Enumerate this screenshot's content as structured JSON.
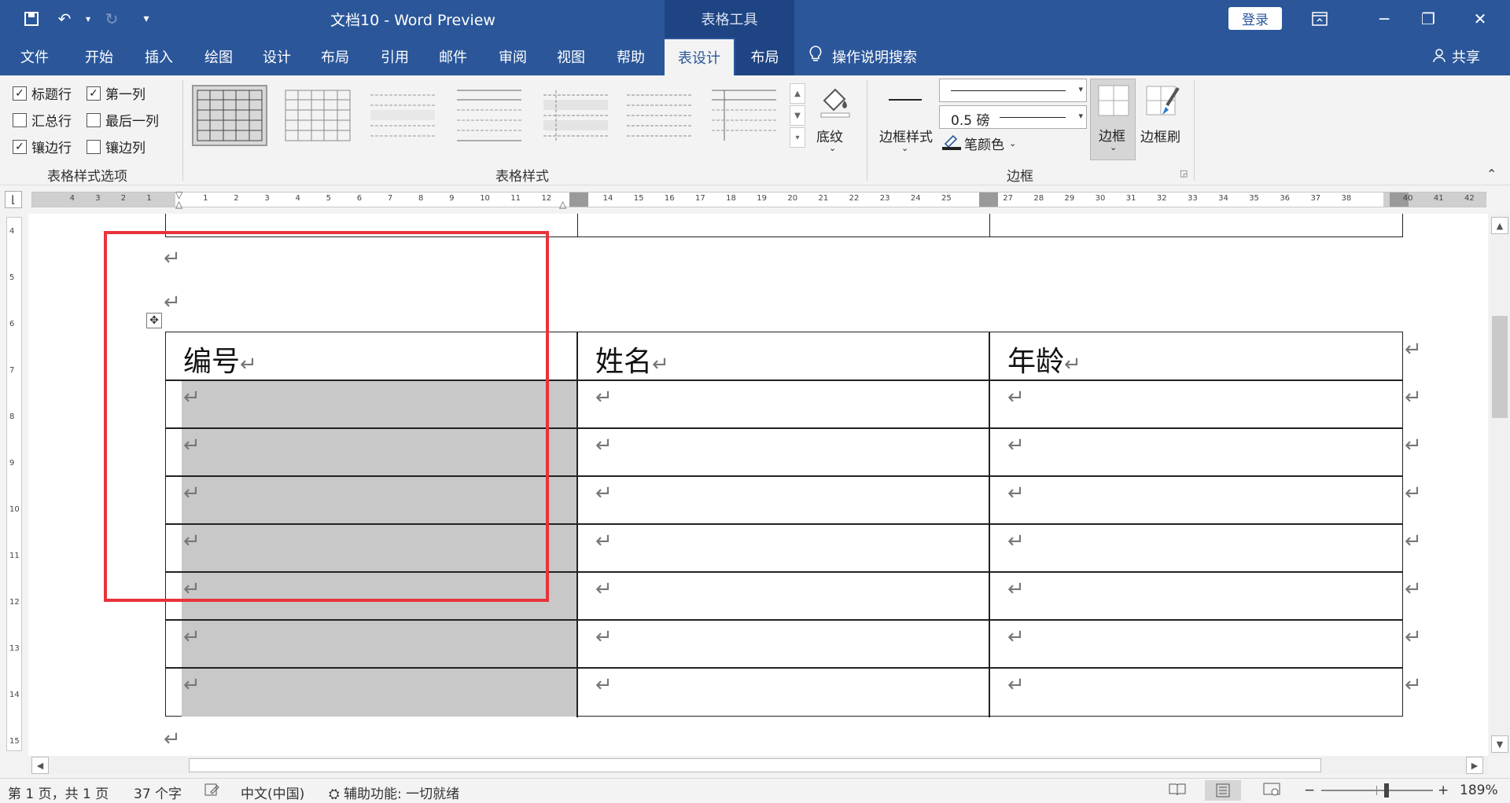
{
  "window": {
    "title": "文档10 - Word Preview",
    "context_tab": "表格工具",
    "login_label": "登录"
  },
  "menu": {
    "tabs": [
      "文件",
      "开始",
      "插入",
      "绘图",
      "设计",
      "布局",
      "引用",
      "邮件",
      "审阅",
      "视图",
      "帮助",
      "表设计",
      "布局"
    ],
    "active_tab": "表设计",
    "search_label": "操作说明搜索",
    "share_label": "共享"
  },
  "ribbon": {
    "style_options": {
      "header_row": {
        "label": "标题行",
        "checked": true
      },
      "first_column": {
        "label": "第一列",
        "checked": true
      },
      "total_row": {
        "label": "汇总行",
        "checked": false
      },
      "last_column": {
        "label": "最后一列",
        "checked": false
      },
      "banded_rows": {
        "label": "镶边行",
        "checked": true
      },
      "banded_columns": {
        "label": "镶边列",
        "checked": false
      },
      "group_label": "表格样式选项"
    },
    "table_styles_group_label": "表格样式",
    "shading_label": "底纹",
    "border_styles_label": "边框样式",
    "pen_weight": "0.5 磅",
    "pen_color_label": "笔颜色",
    "borders_label": "边框",
    "border_painter_label": "边框刷",
    "borders_group_label": "边框"
  },
  "ruler": {
    "left_ticks": [
      "4",
      "3",
      "2",
      "1"
    ],
    "right_ticks": [
      "1",
      "2",
      "3",
      "4",
      "5",
      "6",
      "7",
      "8",
      "9",
      "10",
      "11",
      "12",
      "14",
      "15",
      "16",
      "17",
      "18",
      "19",
      "20",
      "21",
      "22",
      "23",
      "24",
      "25",
      "27",
      "28",
      "29",
      "30",
      "31",
      "32",
      "33",
      "34",
      "35",
      "36",
      "37",
      "38",
      "40",
      "41",
      "42"
    ],
    "vertical_ticks": [
      "4",
      "5",
      "6",
      "7",
      "8",
      "9",
      "10",
      "11",
      "12",
      "13",
      "14",
      "15"
    ]
  },
  "document": {
    "table": {
      "headers": [
        "编号",
        "姓名",
        "年龄"
      ],
      "body_rows": 7
    }
  },
  "status": {
    "page": "第 1 页，共 1 页",
    "words": "37 个字",
    "language": "中文(中国)",
    "accessibility": "辅助功能: 一切就绪",
    "zoom": "189%"
  },
  "colors": {
    "brand": "#2b579a",
    "highlight": "#e8333a",
    "column_shade": "#c8c8c8"
  }
}
